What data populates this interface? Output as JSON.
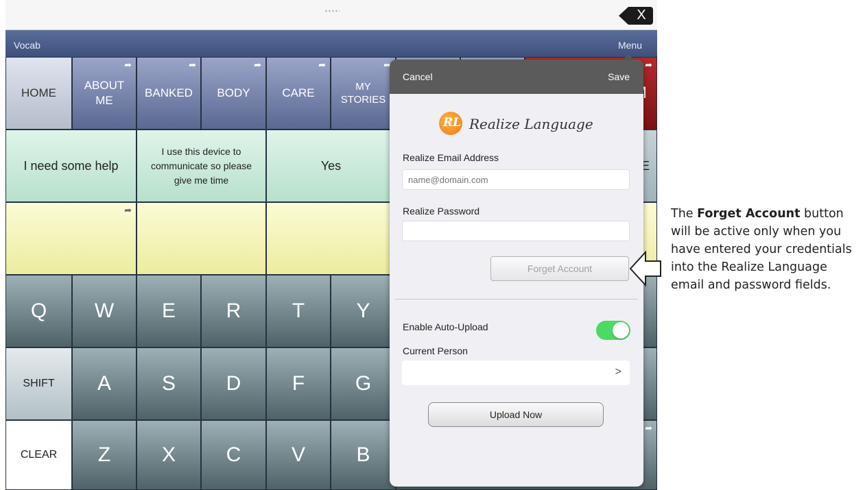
{
  "topbar": {
    "close_label": "X"
  },
  "navbar": {
    "vocab": "Vocab",
    "menu": "Menu"
  },
  "categories": [
    {
      "label": "HOME"
    },
    {
      "label": "ABOUT\nME"
    },
    {
      "label": "BANKED"
    },
    {
      "label": "BODY"
    },
    {
      "label": "CARE"
    },
    {
      "label": "MY\nSTORIES"
    },
    {
      "label": ""
    },
    {
      "label": ""
    },
    {
      "label": "M"
    }
  ],
  "phrases": [
    {
      "label": "I need some help"
    },
    {
      "label": "I use this device to communicate so please give me time"
    },
    {
      "label": "Yes"
    },
    {
      "label": "E"
    }
  ],
  "keys_row1": [
    "Q",
    "W",
    "E",
    "R",
    "T",
    "Y"
  ],
  "keys_row2": [
    "SHIFT",
    "A",
    "S",
    "D",
    "F",
    "G"
  ],
  "keys_row3": [
    "CLEAR",
    "Z",
    "X",
    "C",
    "V",
    "B"
  ],
  "panel": {
    "cancel": "Cancel",
    "save": "Save",
    "logo_text": "Realize Language",
    "logo_mark": "RL",
    "email_label": "Realize Email Address",
    "email_placeholder": "name@domain.com",
    "email_value": "",
    "password_label": "Realize Password",
    "password_value": "",
    "forget_button": "Forget Account",
    "auto_upload_label": "Enable Auto-Upload",
    "auto_upload_on": true,
    "current_person_label": "Current Person",
    "current_person_value": "",
    "upload_button": "Upload Now"
  },
  "annotation": {
    "bold": "Forget Account",
    "before": "The ",
    "after": " button will be active only when you have entered your credentials into the Realize Language email and password fields."
  },
  "colors": {
    "toggle_on": "#4cd964",
    "navbar": "#4a5b88",
    "panel_header": "#5b5b5b"
  }
}
